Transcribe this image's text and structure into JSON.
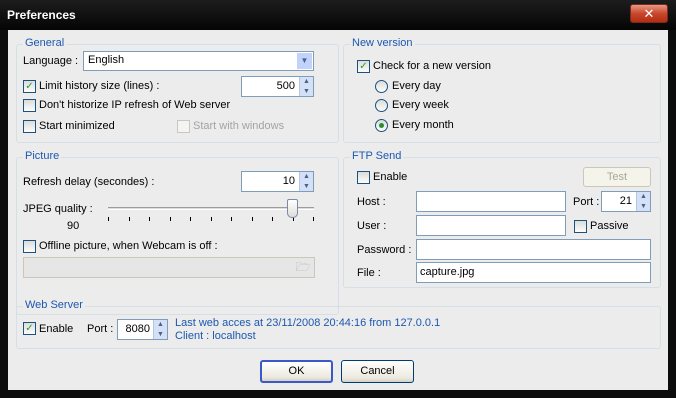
{
  "window": {
    "title": "Preferences",
    "close_glyph": "✕"
  },
  "general": {
    "title": "General",
    "language_label": "Language :",
    "language_value": "English",
    "limit_history_label": "Limit history size (lines) :",
    "limit_history_checked": true,
    "limit_history_value": "500",
    "dont_historize_label": "Don't historize IP refresh of Web server",
    "dont_historize_checked": false,
    "start_minimized_label": "Start minimized",
    "start_minimized_checked": false,
    "start_windows_label": "Start with windows",
    "start_windows_checked": false
  },
  "new_version": {
    "title": "New version",
    "check_label": "Check for a new version",
    "check_checked": true,
    "options": [
      "Every day",
      "Every week",
      "Every month"
    ],
    "selected": "Every month"
  },
  "picture": {
    "title": "Picture",
    "refresh_label": "Refresh delay (secondes) :",
    "refresh_value": "10",
    "jpeg_label": "JPEG quality :",
    "jpeg_value": "90",
    "jpeg_fraction": 0.9,
    "offline_label": "Offline picture, when Webcam is off :",
    "offline_checked": false,
    "offline_path": ""
  },
  "ftp": {
    "title": "FTP Send",
    "enable_label": "Enable",
    "enable_checked": false,
    "test_label": "Test",
    "host_label": "Host :",
    "host_value": "",
    "port_label": "Port :",
    "port_value": "21",
    "user_label": "User :",
    "user_value": "",
    "passive_label": "Passive",
    "passive_checked": false,
    "password_label": "Password :",
    "password_value": "",
    "file_label": "File :",
    "file_value": "capture.jpg"
  },
  "web_server": {
    "title": "Web Server",
    "enable_label": "Enable",
    "enable_checked": true,
    "port_label": "Port :",
    "port_value": "8080",
    "last_access": "Last web acces at 23/11/2008 20:44:16 from 127.0.0.1",
    "client": "Client : localhost"
  },
  "buttons": {
    "ok": "OK",
    "cancel": "Cancel"
  },
  "colors": {
    "accent": "#1b58b0",
    "check_mark": "#21a121"
  }
}
